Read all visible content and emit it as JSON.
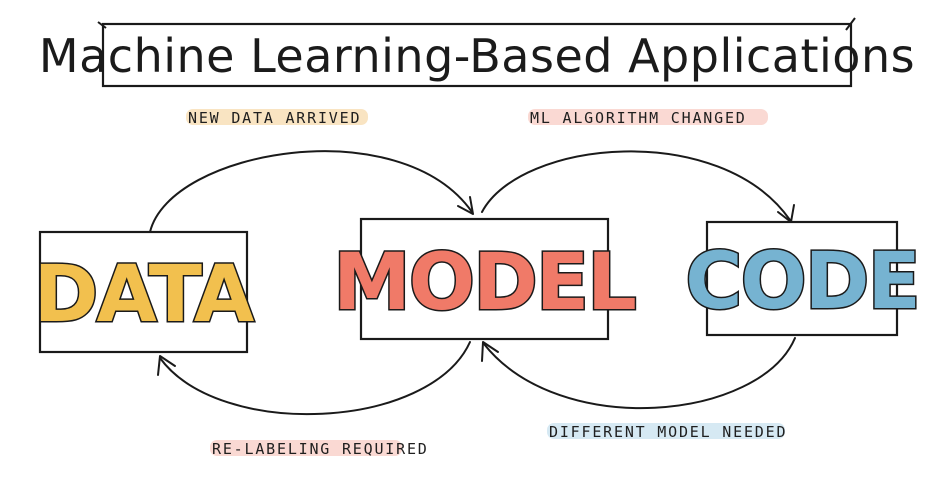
{
  "title": "Machine Learning-Based Applications",
  "nodes": {
    "data": {
      "label": "DATA",
      "color": "#f2c04e"
    },
    "model": {
      "label": "MODEL",
      "color": "#f07a68"
    },
    "code": {
      "label": "CODE",
      "color": "#76b3d1"
    }
  },
  "edges": {
    "new_data": {
      "label": "NEW DATA ARRIVED",
      "highlight": "#f6d9a8"
    },
    "algorithm_changed": {
      "label": "ML ALGORITHM CHANGED",
      "highlight": "#f8c9c0"
    },
    "relabeling": {
      "label": "RE-LABELING REQUIRED",
      "highlight": "#f8c9c0"
    },
    "different_model": {
      "label": "DIFFERENT MODEL NEEDED",
      "highlight": "#c5e0ee"
    }
  }
}
